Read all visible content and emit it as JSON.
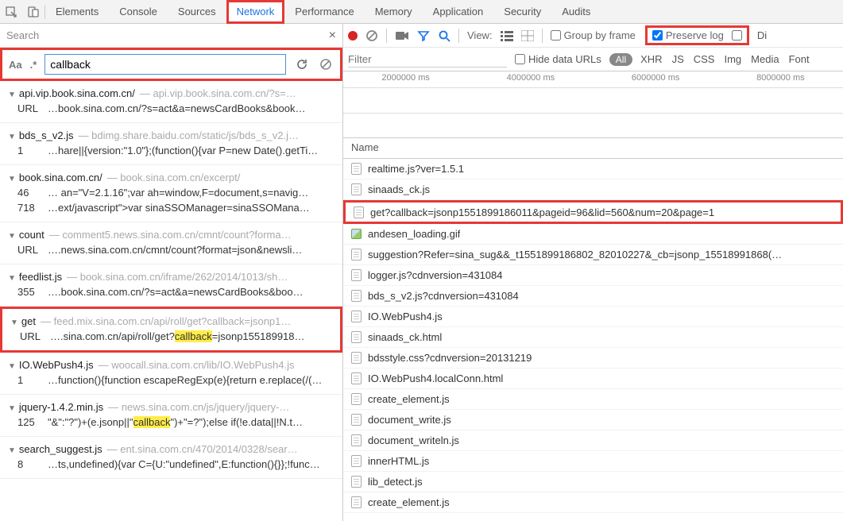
{
  "topbar": {
    "tabs": [
      "Elements",
      "Console",
      "Sources",
      "Network",
      "Performance",
      "Memory",
      "Application",
      "Security",
      "Audits"
    ],
    "active_index": 3
  },
  "left": {
    "search_label": "Search",
    "case_chip": "Aa",
    "regex_chip": ".*",
    "query": "callback",
    "results": [
      {
        "file": "api.vip.book.sina.com.cn/",
        "path": "api.vip.book.sina.com.cn/?s=…",
        "hits": [
          {
            "ln": "URL",
            "before": "…book.sina.com.cn/?s=act&a=newsCardBooks&book…",
            "hl": "",
            "after": ""
          }
        ]
      },
      {
        "file": "bds_s_v2.js",
        "path": "bdimg.share.baidu.com/static/js/bds_s_v2.j…",
        "hits": [
          {
            "ln": "1",
            "before": "…hare||{version:\"1.0\"};(function(){var P=new Date().getTi…",
            "hl": "",
            "after": ""
          }
        ]
      },
      {
        "file": "book.sina.com.cn/",
        "path": "book.sina.com.cn/excerpt/",
        "hits": [
          {
            "ln": "46",
            "before": "… an=\"V=2.1.16\";var ah=window,F=document,s=navig…",
            "hl": "",
            "after": ""
          },
          {
            "ln": "718",
            "before": "…ext/javascript\">var sinaSSOManager=sinaSSOMana…",
            "hl": "",
            "after": ""
          }
        ]
      },
      {
        "file": "count",
        "path": "comment5.news.sina.com.cn/cmnt/count?forma…",
        "hits": [
          {
            "ln": "URL",
            "before": "….news.sina.com.cn/cmnt/count?format=json&newsli…",
            "hl": "",
            "after": ""
          }
        ]
      },
      {
        "file": "feedlist.js",
        "path": "book.sina.com.cn/iframe/262/2014/1013/sh…",
        "hits": [
          {
            "ln": "355",
            "before": "….book.sina.com.cn/?s=act&a=newsCardBooks&boo…",
            "hl": "",
            "after": ""
          }
        ]
      },
      {
        "file": "get",
        "path": "feed.mix.sina.com.cn/api/roll/get?callback=jsonp1…",
        "boxed": true,
        "hits": [
          {
            "ln": "URL",
            "before": "….sina.com.cn/api/roll/get?",
            "hl": "callback",
            "after": "=jsonp155189918…"
          }
        ]
      },
      {
        "file": "IO.WebPush4.js",
        "path": "woocall.sina.com.cn/lib/IO.WebPush4.js",
        "hits": [
          {
            "ln": "1",
            "before": "…function(){function escapeRegExp(e){return e.replace(/(…",
            "hl": "",
            "after": ""
          }
        ]
      },
      {
        "file": "jquery-1.4.2.min.js",
        "path": "news.sina.com.cn/js/jquery/jquery-…",
        "hits": [
          {
            "ln": "125",
            "before": "\"&\":\"?\")+(e.jsonp||\"",
            "hl": "callback",
            "after": "\")+\"=?\");else if(!e.data||!N.t…"
          }
        ]
      },
      {
        "file": "search_suggest.js",
        "path": "ent.sina.com.cn/470/2014/0328/sear…",
        "hits": [
          {
            "ln": "8",
            "before": "…ts,undefined){var C={U:\"undefined\",E:function(){}};!func…",
            "hl": "",
            "after": ""
          }
        ]
      }
    ]
  },
  "right": {
    "view_label": "View:",
    "group_label": "Group by frame",
    "preserve_label": "Preserve log",
    "di_label": "Di",
    "filter_placeholder": "Filter",
    "hide_urls_label": "Hide data URLs",
    "type_pill": "All",
    "types": [
      "XHR",
      "JS",
      "CSS",
      "Img",
      "Media",
      "Font"
    ],
    "timeline_ticks": [
      "2000000 ms",
      "4000000 ms",
      "6000000 ms",
      "8000000 ms"
    ],
    "name_header": "Name",
    "requests": [
      {
        "icon": "doc",
        "name": "realtime.js?ver=1.5.1",
        "faded": true
      },
      {
        "icon": "doc",
        "name": "sinaads_ck.js"
      },
      {
        "icon": "doc",
        "name": "get?callback=jsonp1551899186011&pageid=96&lid=560&num=20&page=1",
        "boxed": true
      },
      {
        "icon": "img",
        "name": "andesen_loading.gif"
      },
      {
        "icon": "doc",
        "name": "suggestion?Refer=sina_sug&&_t1551899186802_82010227&_cb=jsonp_15518991868(…"
      },
      {
        "icon": "doc",
        "name": "logger.js?cdnversion=431084"
      },
      {
        "icon": "doc",
        "name": "bds_s_v2.js?cdnversion=431084"
      },
      {
        "icon": "doc",
        "name": "IO.WebPush4.js"
      },
      {
        "icon": "doc",
        "name": "sinaads_ck.html"
      },
      {
        "icon": "doc",
        "name": "bdsstyle.css?cdnversion=20131219"
      },
      {
        "icon": "doc",
        "name": "IO.WebPush4.localConn.html"
      },
      {
        "icon": "doc",
        "name": "create_element.js"
      },
      {
        "icon": "doc",
        "name": "document_write.js"
      },
      {
        "icon": "doc",
        "name": "document_writeln.js"
      },
      {
        "icon": "doc",
        "name": "innerHTML.js"
      },
      {
        "icon": "doc",
        "name": "lib_detect.js"
      },
      {
        "icon": "doc",
        "name": "create_element.js",
        "faded": true
      }
    ]
  }
}
